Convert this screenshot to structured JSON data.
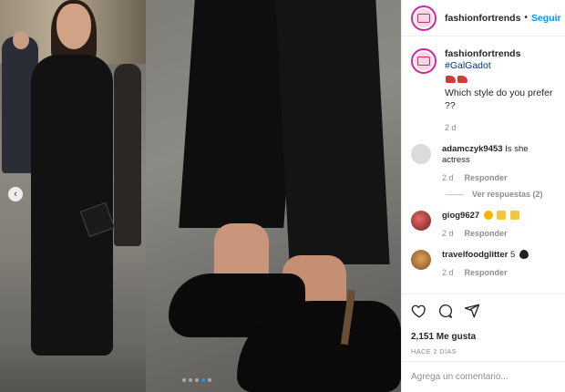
{
  "header": {
    "username": "fashionfortrends",
    "separator": "•",
    "follow_label": "Seguir"
  },
  "caption": {
    "username": "fashionfortrends",
    "hashtag": "#GalGadot",
    "emoji": "red-high-heel-shoe x2",
    "text": "Which style do you prefer ??",
    "age": "2 d"
  },
  "comments": [
    {
      "username": "adamczyk9453",
      "text": "Is she actress",
      "age": "2 d",
      "reply_label": "Responder",
      "avatar": "default-avatar-icon",
      "replies_label": "Ver respuestas (2)"
    },
    {
      "username": "giog9627",
      "text": "",
      "emoji": "smiling-face-hearts, clapping-hands, clapping-hands",
      "age": "2 d",
      "reply_label": "Responder",
      "avatar": "user-avatar"
    },
    {
      "username": "travelfoodglitter",
      "text": "5",
      "emoji": "black-heart",
      "age": "2 d",
      "reply_label": "Responder",
      "avatar": "user-avatar"
    }
  ],
  "actions": {
    "likes": "2,151 Me gusta",
    "posted": "HACE 2 DÍAS",
    "icons": [
      "heart-icon",
      "comment-icon",
      "share-icon"
    ]
  },
  "composer": {
    "placeholder": "Agrega un comentario...",
    "publish_label": ""
  },
  "carousel": {
    "slide_count": 5,
    "active_index": 3
  },
  "colors": {
    "link": "#0095f6",
    "hashtag": "#00376b",
    "muted": "#8e8e8e",
    "dot_active": "#1e95f0"
  }
}
